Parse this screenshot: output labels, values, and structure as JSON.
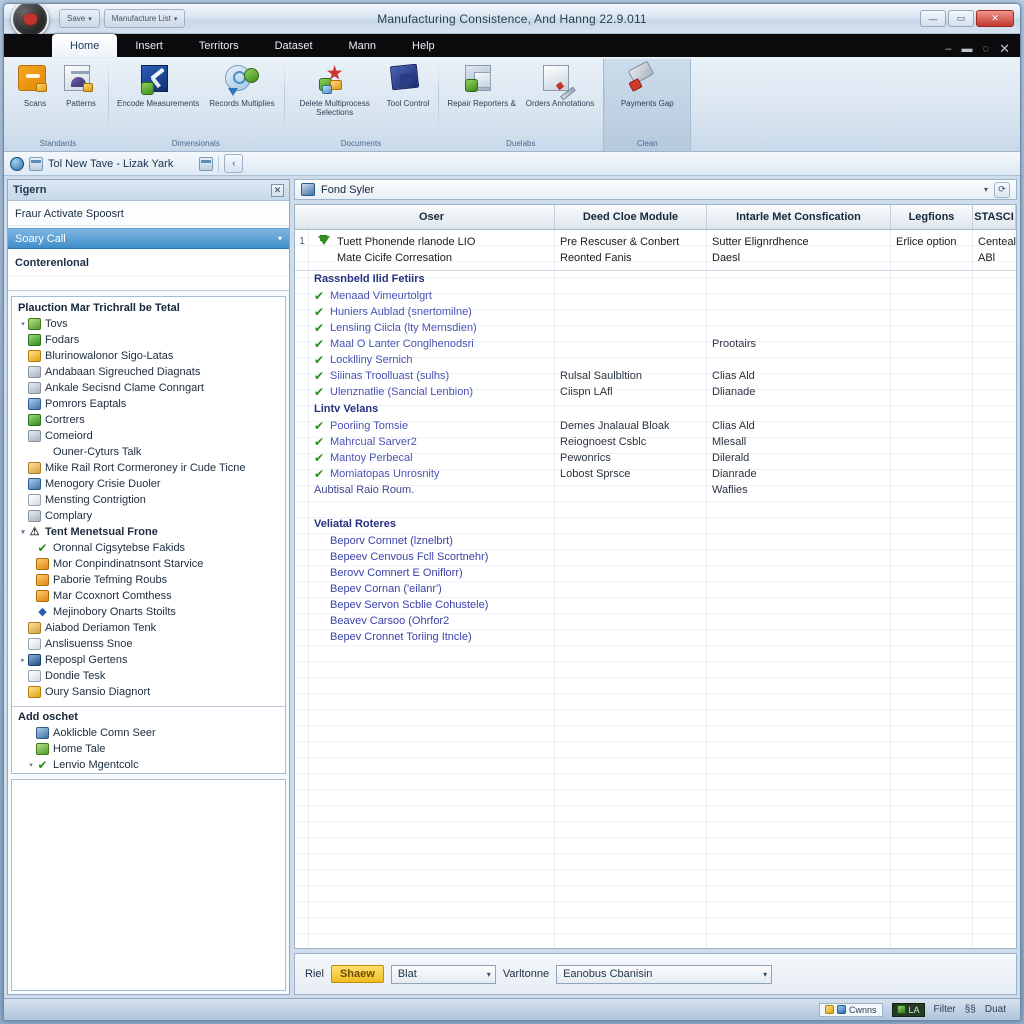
{
  "window": {
    "title": "Manufacturing Consistence, And Hanng 22.9.011",
    "orb_icon": "office-orb-icon",
    "quick_access": [
      {
        "label": "Save",
        "icon": "save-icon"
      },
      {
        "label": "Manufacture List",
        "icon": "list-icon"
      }
    ],
    "caption_buttons": [
      {
        "name": "minimize",
        "glyph": "—"
      },
      {
        "name": "maximize",
        "glyph": "▭"
      },
      {
        "name": "close",
        "glyph": "✕"
      }
    ]
  },
  "ribbon": {
    "tabs": [
      {
        "label": "Home",
        "active": true
      },
      {
        "label": "Insert",
        "active": false
      },
      {
        "label": "Territors",
        "active": false
      },
      {
        "label": "Dataset",
        "active": false
      },
      {
        "label": "Mann",
        "active": false
      },
      {
        "label": "Help",
        "active": false
      }
    ],
    "tab_caption_buttons": [
      {
        "name": "ribbon-minimize",
        "glyph": "–"
      },
      {
        "name": "ribbon-restore",
        "glyph": "▬"
      },
      {
        "name": "ribbon-help",
        "glyph": "◌"
      },
      {
        "name": "ribbon-close",
        "glyph": "✕"
      }
    ],
    "groups": [
      {
        "title": "Standards",
        "highlight": false,
        "buttons": [
          {
            "label": "Scans",
            "icon": "folder-orange-icon"
          },
          {
            "label": "Patterns",
            "icon": "document-lock-icon"
          }
        ]
      },
      {
        "title": "Dimensionals",
        "highlight": false,
        "buttons": [
          {
            "label": "Encode Measurements",
            "icon": "hammer-blue-icon"
          },
          {
            "label": "Records Multiplies",
            "icon": "globe-refresh-icon"
          }
        ]
      },
      {
        "title": "Documents",
        "highlight": false,
        "buttons": [
          {
            "label": "Delete Multiprocess Selections",
            "icon": "star-burst-icon"
          },
          {
            "label": "Tool Control",
            "icon": "book-blue-icon"
          }
        ]
      },
      {
        "title": "Duelabs",
        "highlight": false,
        "buttons": [
          {
            "label": "Repair Reporters &",
            "icon": "page-check-icon"
          },
          {
            "label": "Orders Annotations",
            "icon": "pen-edit-icon"
          }
        ]
      },
      {
        "title": "Clean",
        "highlight": true,
        "buttons": [
          {
            "label": "Payments Gap",
            "icon": "eraser-icon"
          }
        ]
      }
    ]
  },
  "navbar": {
    "breadcrumb": "Tol New Tave - Lizak Yark",
    "icons": [
      "globe-icon",
      "calendar-icon",
      "copy-icon"
    ],
    "back_glyph": "‹",
    "forward_glyph": "›"
  },
  "left_pane": {
    "search_label": "Tigern",
    "close_glyph": "✕",
    "info_line": "Fraur Activate Spoosrt",
    "selected_value": "Soary Call",
    "caret_glyph": "▾",
    "sub_label": "Conterenlonal",
    "tree_title": "Plauction Mar Trichrall be Tetal",
    "tree": [
      {
        "label": "Tovs",
        "level": 0,
        "icon": "image-icon",
        "twist": "▾",
        "bold": false
      },
      {
        "label": "Fodars",
        "level": 0,
        "icon": "folder-green-icon",
        "twist": "",
        "bold": false
      },
      {
        "label": "Blurinowalonor Sigo-Latas",
        "level": 0,
        "icon": "clock-gold-icon",
        "twist": "",
        "bold": false
      },
      {
        "label": "Andabaan Sigreuched Diagnats",
        "level": 0,
        "icon": "grey-box-icon",
        "twist": "",
        "bold": false
      },
      {
        "label": "Ankale Secisnd Clame Conngart",
        "level": 0,
        "icon": "grey-box-icon",
        "twist": "",
        "bold": false
      },
      {
        "label": "Pomrors Eaptals",
        "level": 0,
        "icon": "blue-box-icon",
        "twist": "",
        "bold": false
      },
      {
        "label": "Cortrers",
        "level": 0,
        "icon": "folder-green-icon",
        "twist": "",
        "bold": false
      },
      {
        "label": "Comeiord",
        "level": 0,
        "icon": "grey-box-icon",
        "twist": "",
        "bold": false
      },
      {
        "label": "Ouner-Cyturs Talk",
        "level": 1,
        "icon": "none",
        "twist": "",
        "bold": false
      },
      {
        "label": "Mike Rail Rort Cormeroney ir Cude Ticne",
        "level": 0,
        "icon": "tan-box-icon",
        "twist": "",
        "bold": false
      },
      {
        "label": "Menogory Crisie Duoler",
        "level": 0,
        "icon": "blue-box-icon",
        "twist": "",
        "bold": false
      },
      {
        "label": "Mensting Contrigtion",
        "level": 0,
        "icon": "white-box-icon",
        "twist": "",
        "bold": false
      },
      {
        "label": "Complary",
        "level": 0,
        "icon": "grey-box-icon",
        "twist": "",
        "bold": false
      },
      {
        "label": "Tent Menetsual Frone",
        "level": 0,
        "icon": "warning-icon",
        "twist": "▾",
        "bold": true
      },
      {
        "label": "Oronnal Cigsytebse Fakids",
        "level": 1,
        "icon": "check-icon",
        "twist": "",
        "bold": false
      },
      {
        "label": "Mor Conpindinatnsont Starvice",
        "level": 1,
        "icon": "orange-box-icon",
        "twist": "",
        "bold": false
      },
      {
        "label": "Paborie Tefming Roubs",
        "level": 1,
        "icon": "orange-box-icon",
        "twist": "",
        "bold": false
      },
      {
        "label": "Mar Ccoxnort Comthess",
        "level": 1,
        "icon": "orange-box-icon",
        "twist": "",
        "bold": false
      },
      {
        "label": "Mejinobory Onarts Stoilts",
        "level": 1,
        "icon": "diamond-icon",
        "twist": "",
        "bold": false
      },
      {
        "label": "Aiabod Deriamon Tenk",
        "level": 0,
        "icon": "tan-box-icon",
        "twist": "",
        "bold": false
      },
      {
        "label": "Anslisuenss Snoe",
        "level": 0,
        "icon": "white-box-icon",
        "twist": "",
        "bold": false
      },
      {
        "label": "Repospl Gertens",
        "level": 0,
        "icon": "navy-box-icon",
        "twist": "▸",
        "bold": false
      },
      {
        "label": "Dondie Tesk",
        "level": 0,
        "icon": "white-box-icon",
        "twist": "",
        "bold": false
      },
      {
        "label": "Oury Sansio Diagnort",
        "level": 0,
        "icon": "gold-box-icon",
        "twist": "",
        "bold": false
      }
    ],
    "foot_title": "Add oschet",
    "foot_tree": [
      {
        "label": "Aoklicble Comn Seer",
        "level": 1,
        "icon": "blue-box-icon",
        "twist": "",
        "bold": false
      },
      {
        "label": "Home Tale",
        "level": 1,
        "icon": "image-icon",
        "twist": "",
        "bold": false
      },
      {
        "label": "Lenvio Mgentcolc",
        "level": 1,
        "icon": "check-big-icon",
        "twist": "▾",
        "bold": false
      }
    ]
  },
  "document": {
    "title": "Fond Syler",
    "icon": "document-blue-icon",
    "caret_glyph": "▾",
    "refresh_glyph": "⟳"
  },
  "grid": {
    "columns": [
      "Oser",
      "Deed Cloe Module",
      "Intarle Met Consfication",
      "Legfions",
      "STASCI"
    ],
    "first_row": {
      "number": "1",
      "icon": "download-green-icon",
      "name_line1": "Tuett Phonende rlanode LIO",
      "name_line2": "Mate Cicife Corresation",
      "module_line1": "Pre Rescuser & Conbert",
      "module_line2": "Reonted Fanis",
      "confication_line1": "Sutter Elignrdhence",
      "confication_line2": "Daesl",
      "legions": "Erlice option",
      "stasci_line1": "Centeal",
      "stasci_line2": "ABl"
    },
    "sections": [
      {
        "title": "Rassnbeld Ilid Fetiirs",
        "items": [
          {
            "check": true,
            "label": "Menaad Vimeurtolgrt",
            "module": "",
            "confication": ""
          },
          {
            "check": true,
            "label": "Huniers Aublad (snertomilne)",
            "module": "",
            "confication": ""
          },
          {
            "check": true,
            "label": "Lensiing Ciicla (lty Mernsdien)",
            "module": "",
            "confication": ""
          },
          {
            "check": true,
            "label": "Maal O Lanter Conglhenodsri",
            "module": "",
            "confication": "Prootairs"
          },
          {
            "check": true,
            "label": "Locklliny Sernich",
            "module": "",
            "confication": ""
          },
          {
            "check": true,
            "label": "Siiinas Troolluast (sulhs)",
            "module": "Rulsal Saulbltion",
            "confication": "Clias Ald"
          },
          {
            "check": true,
            "label": "Ulenznatlie (Sancial Lenbion)",
            "module": "Ciispn LAfl",
            "confication": "Dlianade"
          }
        ]
      },
      {
        "title": "Lintv Velans",
        "items": [
          {
            "check": true,
            "label": "Pooriing Tomsie",
            "module": "Demes Jnalaual Bloak",
            "confication": "Clias Ald"
          },
          {
            "check": true,
            "label": "Mahrcual Sarver2",
            "module": "Reiognoest Csblc",
            "confication": "Mlesall"
          },
          {
            "check": true,
            "label": "Mantoy Perbecal",
            "module": "Pewonrics",
            "confication": "Dilerald"
          },
          {
            "check": true,
            "label": "Momiatopas Unrosnity",
            "module": "Lobost Sprsce",
            "confication": "Dianrade"
          }
        ],
        "note": "Aubtisal Raio Roum.",
        "note_extra_confication": "Waflies"
      },
      {
        "title": "Veliatal Roteres",
        "items": [
          {
            "check": false,
            "label": "Beporv Cornnet (lznelbrt)",
            "module": "",
            "confication": ""
          },
          {
            "check": false,
            "label": "Bepeev Cenvous Fcll Scortnehr)",
            "module": "",
            "confication": ""
          },
          {
            "check": false,
            "label": "Berovv Comnert E Oniflorr)",
            "module": "",
            "confication": ""
          },
          {
            "check": false,
            "label": "Bepev Cornan ('eilanr')",
            "module": "",
            "confication": ""
          },
          {
            "check": false,
            "label": "Bepev Servon Scblie Cohustele)",
            "module": "",
            "confication": ""
          },
          {
            "check": false,
            "label": "Beavev Carsoo (Ohrfor2",
            "module": "",
            "confication": ""
          },
          {
            "check": false,
            "label": "Bepev Cronnet Toriing Itncle)",
            "module": "",
            "confication": ""
          }
        ]
      }
    ]
  },
  "options_bar": {
    "label1": "Riel",
    "pill": "Shaew",
    "select1_value": "Blat",
    "label2": "Varltonne",
    "select2_value": "Eanobus Cbanisin",
    "caret_glyph": "▾"
  },
  "statusbar": {
    "chip_label": "Cwnns",
    "dark_label": "LA",
    "text1": "Filter",
    "glyph": "§§",
    "text2": "Duat"
  },
  "colors": {
    "accent_blue": "#3f8ec9",
    "link_blue": "#4a51b5",
    "section_title": "#26317f",
    "check_green": "#2e8b21",
    "pill_yellow": "#f1bc22",
    "close_red": "#c03a2e"
  }
}
